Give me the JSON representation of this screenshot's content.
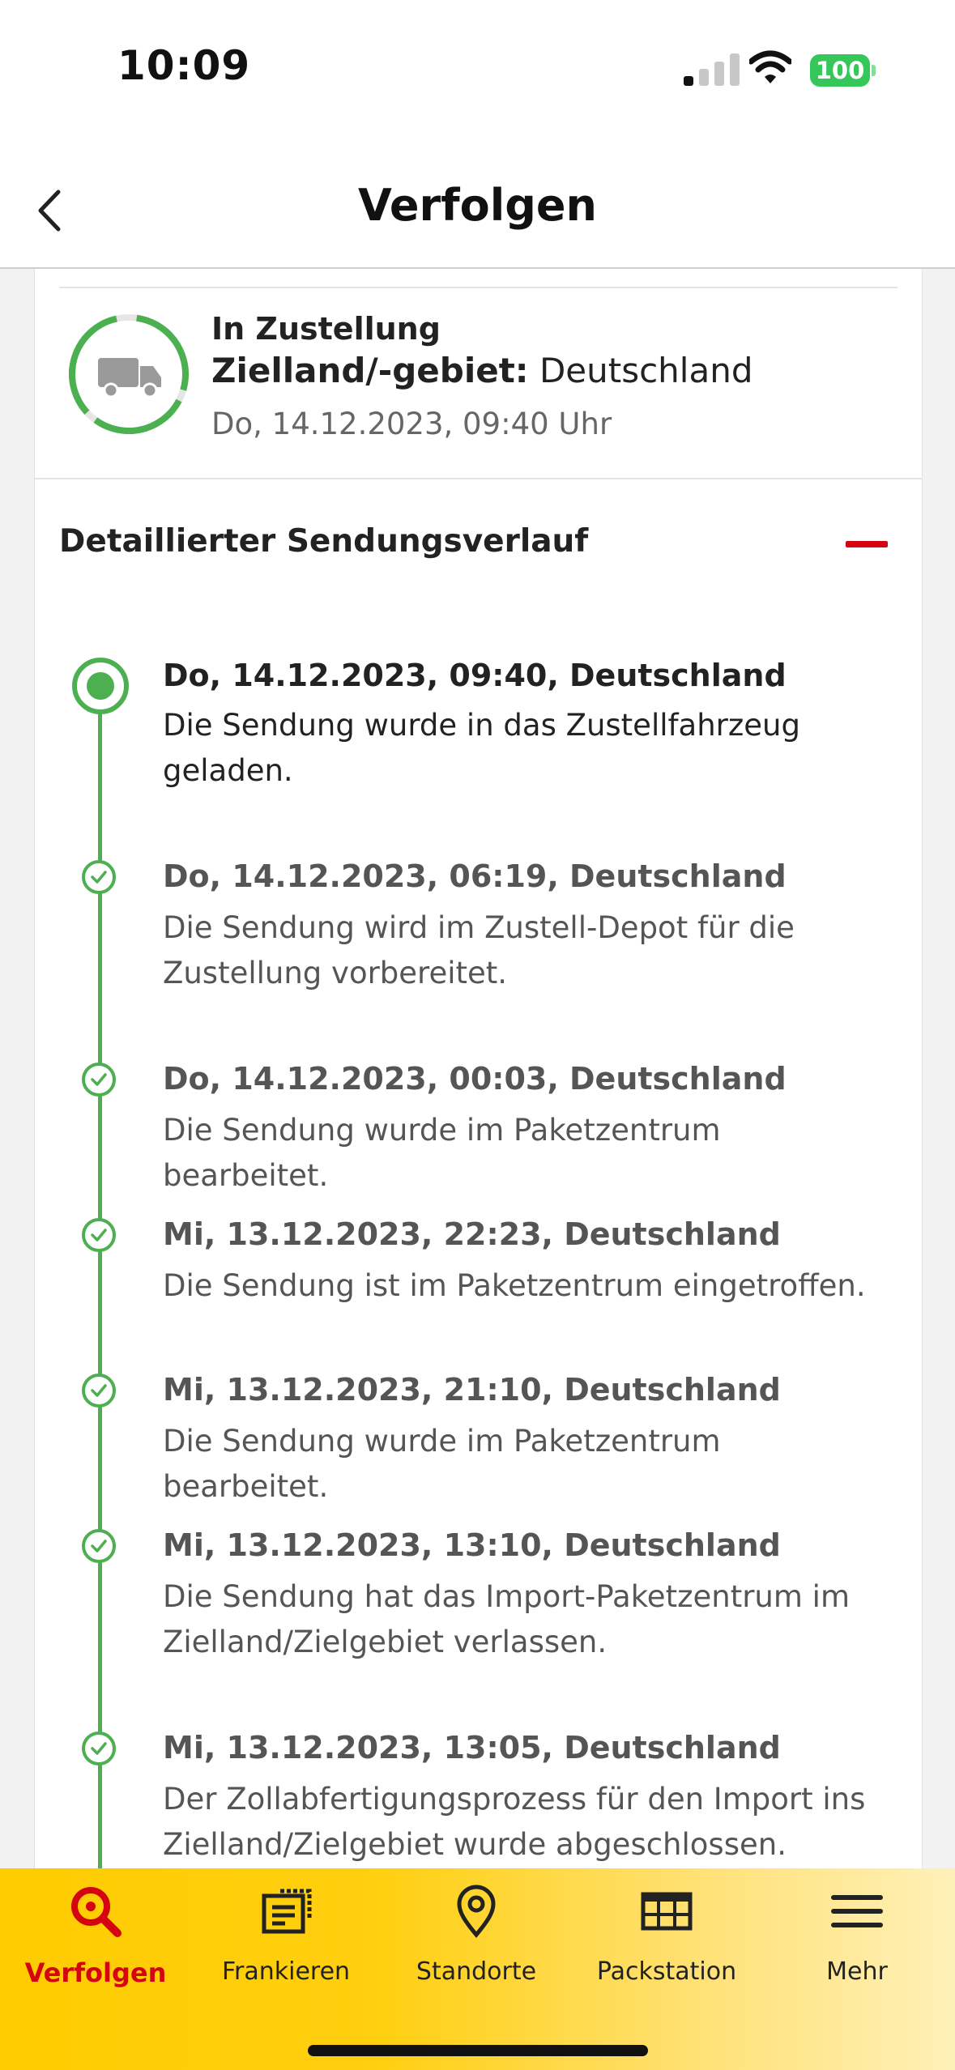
{
  "status_bar": {
    "time": "10:09",
    "battery": "100"
  },
  "header": {
    "title": "Verfolgen"
  },
  "shipment": {
    "status": "In Zustellung",
    "destination_label": "Zielland/-gebiet:",
    "destination_value": "Deutschland",
    "timestamp": "Do, 14.12.2023, 09:40 Uhr"
  },
  "history": {
    "title": "Detaillierter Sendungsverlauf",
    "events": [
      {
        "head": "Do, 14.12.2023, 09:40, Deutschland",
        "desc": "Die Sendung wurde in das Zustellfahrzeug geladen."
      },
      {
        "head": "Do, 14.12.2023, 06:19, Deutschland",
        "desc": "Die Sendung wird im Zustell-Depot für die Zustellung vorbereitet."
      },
      {
        "head": "Do, 14.12.2023, 00:03, Deutschland",
        "desc": "Die Sendung wurde im Paketzentrum bearbeitet."
      },
      {
        "head": "Mi, 13.12.2023, 22:23, Deutschland",
        "desc": "Die Sendung ist im Paketzentrum eingetroffen."
      },
      {
        "head": "Mi, 13.12.2023, 21:10, Deutschland",
        "desc": "Die Sendung wurde im Paketzentrum bearbeitet."
      },
      {
        "head": "Mi, 13.12.2023, 13:10, Deutschland",
        "desc": "Die Sendung hat das Import-Paketzentrum im Zielland/Zielgebiet verlassen."
      },
      {
        "head": "Mi, 13.12.2023, 13:05, Deutschland",
        "desc": "Der Zollabfertigungsprozess für den Import ins Zielland/Zielgebiet wurde abgeschlossen."
      }
    ]
  },
  "tabs": [
    {
      "label": "Verfolgen",
      "icon": "search-icon",
      "active": true
    },
    {
      "label": "Frankieren",
      "icon": "stamp-icon",
      "active": false
    },
    {
      "label": "Standorte",
      "icon": "location-pin-icon",
      "active": false
    },
    {
      "label": "Packstation",
      "icon": "packstation-icon",
      "active": false
    },
    {
      "label": "Mehr",
      "icon": "menu-icon",
      "active": false
    }
  ],
  "colors": {
    "accent_red": "#d40511",
    "dhl_yellow": "#ffcc00",
    "success_green": "#4caf50"
  }
}
